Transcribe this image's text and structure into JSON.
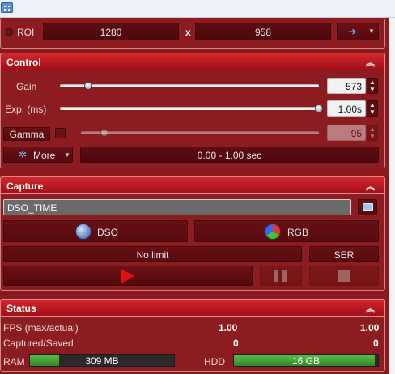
{
  "roi": {
    "label": "ROI",
    "width": "1280",
    "separator": "x",
    "height": "958",
    "arrow_icon": "arrow-right-icon"
  },
  "control": {
    "title": "Control",
    "gain": {
      "label": "Gain",
      "value": "573",
      "level": 0.11
    },
    "exposure": {
      "label": "Exp. (ms)",
      "value": "1.00s",
      "level": 1.0
    },
    "gamma": {
      "label": "Gamma",
      "value": "95",
      "level": 0.1
    },
    "more_label": "More",
    "range_text": "0.00 - 1.00 sec"
  },
  "capture": {
    "title": "Capture",
    "filename": "DSO_TIME",
    "dso_label": "DSO",
    "rgb_label": "RGB",
    "limit_label": "No limit",
    "format_label": "SER"
  },
  "status": {
    "title": "Status",
    "fps_label": "FPS (max/actual)",
    "fps_max": "1.00",
    "fps_actual": "1.00",
    "captured_label": "Captured/Saved",
    "captured": "0",
    "saved": "0",
    "ram_label": "RAM",
    "ram_value": "309 MB",
    "ram_level": 0.2,
    "hdd_label": "HDD",
    "hdd_value": "16 GB",
    "hdd_level": 0.98
  }
}
